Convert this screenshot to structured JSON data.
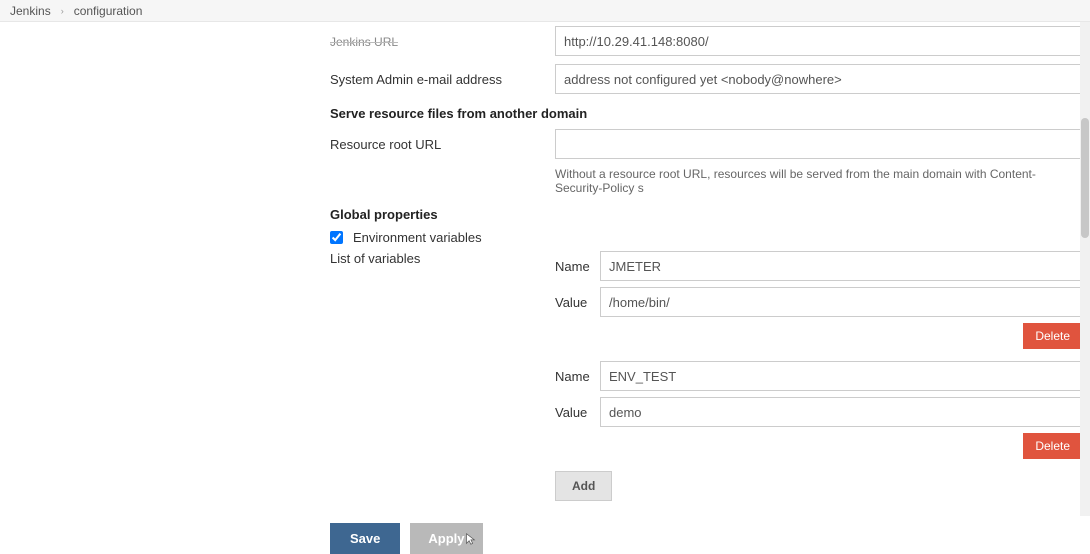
{
  "breadcrumb": {
    "items": [
      "Jenkins",
      "configuration"
    ]
  },
  "form": {
    "jenkins_url_label": "Jenkins URL",
    "jenkins_url_value": "http://10.29.41.148:8080/",
    "admin_email_label": "System Admin e-mail address",
    "admin_email_value": "address not configured yet <nobody@nowhere>",
    "serve_section": "Serve resource files from another domain",
    "resource_root_label": "Resource root URL",
    "resource_root_value": "",
    "resource_root_help": "Without a resource root URL, resources will be served from the main domain with Content-Security-Policy s",
    "global_props_section": "Global properties",
    "env_vars_checkbox_label": "Environment variables",
    "env_vars_checked": true,
    "list_label": "List of variables",
    "kv": {
      "name_label": "Name",
      "value_label": "Value"
    },
    "vars": [
      {
        "name": "JMETER",
        "value": "/home/bin/"
      },
      {
        "name": "ENV_TEST",
        "value": "demo"
      }
    ],
    "buttons": {
      "delete": "Delete",
      "add": "Add",
      "save": "Save",
      "apply": "Apply"
    }
  }
}
